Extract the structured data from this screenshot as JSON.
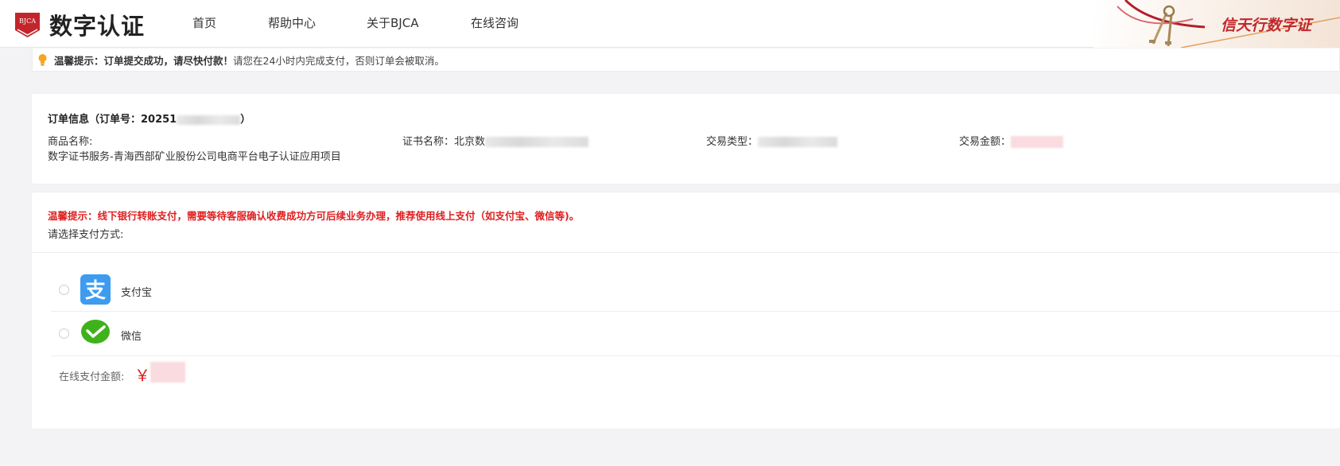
{
  "header": {
    "logo_badge": "BJCA",
    "logo_text": "数字认证",
    "nav": [
      "首页",
      "帮助中心",
      "关于BJCA",
      "在线咨询"
    ],
    "slogan": "信天行数字证"
  },
  "notice": {
    "strong": "温馨提示：订单提交成功，请尽快付款！",
    "text": "请您在24小时内完成支付，否则订单会被取消。"
  },
  "order": {
    "title_prefix": "订单信息（订单号：20251",
    "title_suffix": "）",
    "product_label": "商品名称:",
    "product_value": "数字证书服务-青海西部矿业股份公司电商平台电子认证应用项目",
    "cert_label": "证书名称：",
    "cert_value_prefix": "北京数",
    "trade_type_label": "交易类型：",
    "trade_amount_label": "交易金额："
  },
  "payment": {
    "warning": "温馨提示：线下银行转账支付，需要等待客服确认收费成功方可后续业务办理，推荐使用线上支付（如支付宝、微信等)。",
    "select_label": "请选择支付方式:",
    "methods": [
      {
        "label": "支付宝",
        "icon": "alipay-icon"
      },
      {
        "label": "微信",
        "icon": "wechat-icon"
      }
    ],
    "amount_label": "在线支付金额:",
    "currency": "￥"
  },
  "colors": {
    "accent_red": "#e02020",
    "brand_red": "#c0282c",
    "alipay_blue": "#3d9cf0",
    "wechat_green": "#3fb21b"
  }
}
